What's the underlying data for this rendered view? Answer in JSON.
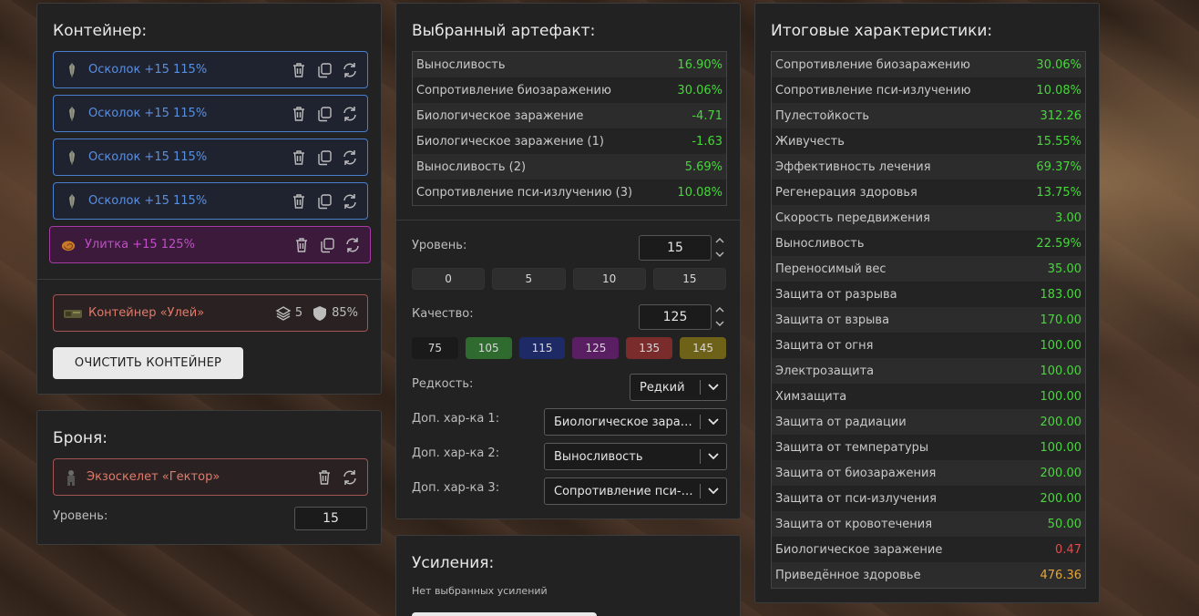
{
  "container": {
    "title": "Контейнер:",
    "slots": [
      {
        "label": "Осколок +15 115%",
        "icon": "shard-artifact-icon"
      },
      {
        "label": "Осколок +15 115%",
        "icon": "shard-artifact-icon"
      },
      {
        "label": "Осколок +15 115%",
        "icon": "shard-artifact-icon"
      },
      {
        "label": "Осколок +15 115%",
        "icon": "shard-artifact-icon"
      },
      {
        "label": "Улитка +15 125%",
        "icon": "snail-artifact-icon"
      }
    ],
    "container_item": {
      "label": "Контейнер «Улей»",
      "slots": "5",
      "protection": "85%"
    },
    "clear_button": "ОЧИСТИТЬ КОНТЕЙНЕР"
  },
  "armor": {
    "title": "Броня:",
    "item": "Экзоскелет «Гектор»",
    "level_label": "Уровень:",
    "level_value": "15"
  },
  "artifact": {
    "title": "Выбранный артефакт:",
    "stats": [
      {
        "name": "Выносливость",
        "value": "16.90%",
        "tone": "green"
      },
      {
        "name": "Сопротивление биозаражению",
        "value": "30.06%",
        "tone": "green"
      },
      {
        "name": "Биологическое заражение",
        "value": "-4.71",
        "tone": "green"
      },
      {
        "name": "Биологическое заражение (1)",
        "value": "-1.63",
        "tone": "green"
      },
      {
        "name": "Выносливость (2)",
        "value": "5.69%",
        "tone": "green"
      },
      {
        "name": "Сопротивление пси-излучению (3)",
        "value": "10.08%",
        "tone": "green"
      }
    ],
    "level_label": "Уровень:",
    "level_value": "15",
    "level_presets": [
      "0",
      "5",
      "10",
      "15"
    ],
    "quality_label": "Качество:",
    "quality_value": "125",
    "quality_presets": [
      {
        "label": "75",
        "color": "#1a1a1a"
      },
      {
        "label": "105",
        "color": "#2f6a2f"
      },
      {
        "label": "115",
        "color": "#1e2a66"
      },
      {
        "label": "125",
        "color": "#5a1f63"
      },
      {
        "label": "135",
        "color": "#7a2b2b"
      },
      {
        "label": "145",
        "color": "#6e6118"
      }
    ],
    "rarity_label": "Редкость:",
    "rarity_value": "Редкий",
    "extra1_label": "Доп. хар-ка 1:",
    "extra1_value": "Биологическое заражение",
    "extra2_label": "Доп. хар-ка 2:",
    "extra2_value": "Выносливость",
    "extra3_label": "Доп. хар-ка 3:",
    "extra3_value": "Сопротивление пси-излучению"
  },
  "boosts": {
    "title": "Усиления:",
    "empty_text": "Нет выбранных усилений"
  },
  "totals": {
    "title": "Итоговые характеристики:",
    "stats": [
      {
        "name": "Сопротивление биозаражению",
        "value": "30.06%",
        "tone": "green"
      },
      {
        "name": "Сопротивление пси-излучению",
        "value": "10.08%",
        "tone": "green"
      },
      {
        "name": "Пулестойкость",
        "value": "312.26",
        "tone": "green"
      },
      {
        "name": "Живучесть",
        "value": "15.55%",
        "tone": "green"
      },
      {
        "name": "Эффективность лечения",
        "value": "69.37%",
        "tone": "green"
      },
      {
        "name": "Регенерация здоровья",
        "value": "13.75%",
        "tone": "green"
      },
      {
        "name": "Скорость передвижения",
        "value": "3.00",
        "tone": "green"
      },
      {
        "name": "Выносливость",
        "value": "22.59%",
        "tone": "green"
      },
      {
        "name": "Переносимый вес",
        "value": "35.00",
        "tone": "green"
      },
      {
        "name": "Защита от разрыва",
        "value": "183.00",
        "tone": "green"
      },
      {
        "name": "Защита от взрыва",
        "value": "170.00",
        "tone": "green"
      },
      {
        "name": "Защита от огня",
        "value": "100.00",
        "tone": "green"
      },
      {
        "name": "Электрозащита",
        "value": "100.00",
        "tone": "green"
      },
      {
        "name": "Химзащита",
        "value": "100.00",
        "tone": "green"
      },
      {
        "name": "Защита от радиации",
        "value": "200.00",
        "tone": "green"
      },
      {
        "name": "Защита от температуры",
        "value": "100.00",
        "tone": "green"
      },
      {
        "name": "Защита от биозаражения",
        "value": "200.00",
        "tone": "green"
      },
      {
        "name": "Защита от пси-излучения",
        "value": "200.00",
        "tone": "green"
      },
      {
        "name": "Защита от кровотечения",
        "value": "50.00",
        "tone": "green"
      },
      {
        "name": "Биологическое заражение",
        "value": "0.47",
        "tone": "red"
      },
      {
        "name": "Приведённое здоровье",
        "value": "476.36",
        "tone": "gold"
      }
    ]
  },
  "colors": {
    "panel_bg": "#222222",
    "slot_blue": "#4a7fd0",
    "slot_purple": "#a53ba3",
    "container_red": "#a35454",
    "value_green": "#48d63c",
    "value_red": "#e24b4b",
    "value_gold": "#e3a53a"
  }
}
